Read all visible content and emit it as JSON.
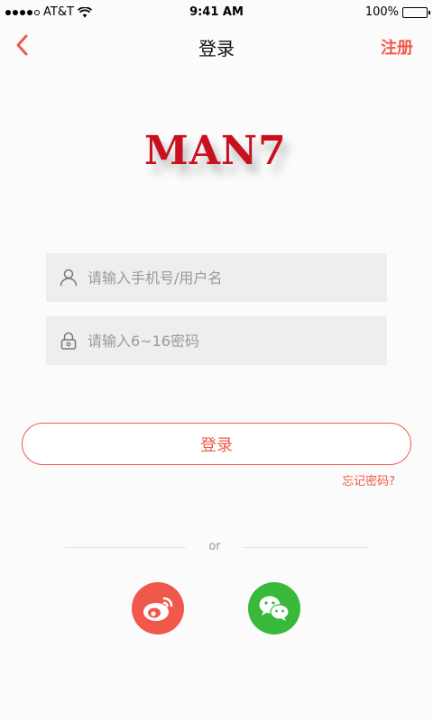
{
  "status_bar": {
    "carrier": "AT&T",
    "time": "9:41 AM",
    "battery": "100%"
  },
  "nav": {
    "title": "登录",
    "register_label": "注册"
  },
  "logo": {
    "text": "MAN7"
  },
  "form": {
    "username_placeholder": "请输入手机号/用户名",
    "password_placeholder": "请输入6~16密码",
    "login_label": "登录",
    "forgot_label": "忘记密码?"
  },
  "divider": {
    "text": "or"
  },
  "social": {
    "weibo_icon": "weibo-icon",
    "wechat_icon": "wechat-icon"
  },
  "colors": {
    "accent": "#f05a4a",
    "wechat": "#38b93a",
    "logo_red": "#c8101e"
  }
}
